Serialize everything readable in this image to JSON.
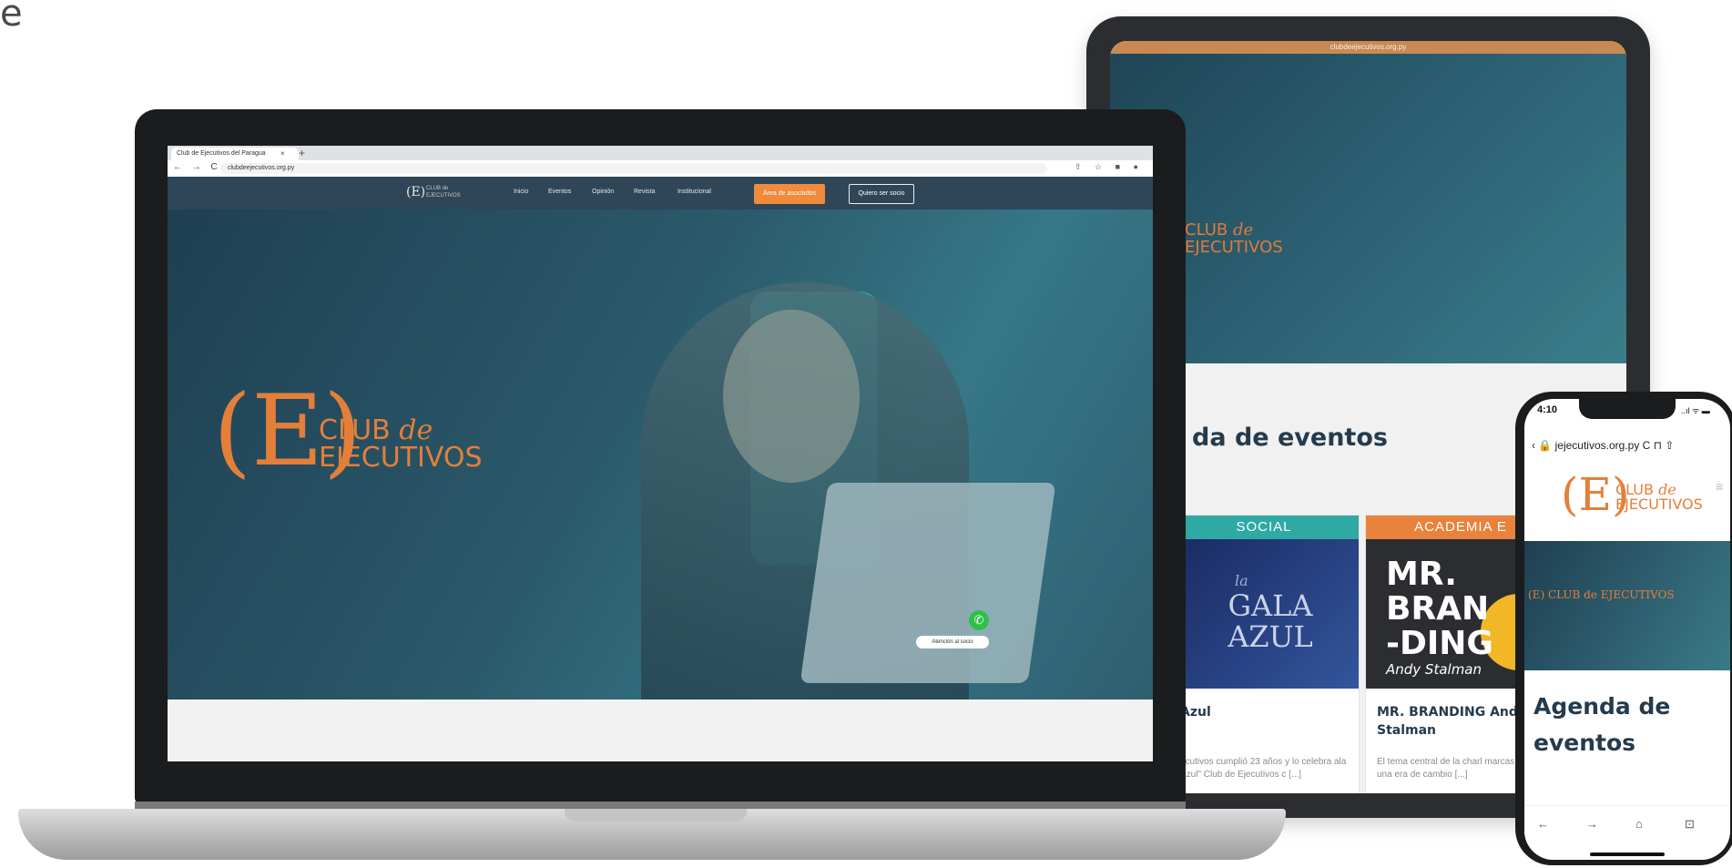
{
  "corner_text": "e",
  "tablet": {
    "url": "clubdeejecutivos.org.py",
    "logo_line1": "CLUB",
    "logo_de": "de",
    "logo_line2": "EJECUTIVOS",
    "section_title": "da de eventos",
    "cards": [
      {
        "tag": "SOCIAL",
        "img_script": "la",
        "img_line1": "GALA",
        "img_line2": "AZUL",
        "title": "Azul",
        "text": "ecutivos cumplió 23 años y lo celebra ala Azul\" Club de Ejecutivos c [...]"
      },
      {
        "tag": "ACADEMIA E",
        "img_line1": "MR.",
        "img_line2": "BRAN",
        "img_line3": "-DING",
        "img_sub": "Andy Stalman",
        "title": "MR. BRANDING Andy Stalman",
        "text": "El tema central de la charl marcas no es una era de cambio [...]"
      }
    ]
  },
  "laptop": {
    "tab_title": "Club de Ejecutivos del Paragua",
    "tab_close": "×",
    "new_tab": "+",
    "nav_buttons": "← → C",
    "address": "clubdeejecutivos.org.py",
    "actions": "⇧ ☆ ■ ●",
    "nav": {
      "logo_mark": "(E)",
      "logo_club": "CLUB de",
      "logo_ejecutivos": "EJECUTIVOS",
      "items": [
        "Inicio",
        "Eventos",
        "Opinión",
        "Revista",
        "Institucional"
      ],
      "cta": "Área de asociados",
      "outline": "Quiero ser socio"
    },
    "hero": {
      "logo_mark": "(E)",
      "logo_line1": "CLUB",
      "logo_de": "de",
      "logo_line2": "EJECUTIVOS",
      "atencion": "Atención al socio"
    }
  },
  "phone": {
    "time": "4:10",
    "status": "..ıl ᯤ ▬",
    "url_bar": "‹  🔒 jejecutivos.org.py  C  ⊓  ⇧",
    "logo_mark": "(E)",
    "logo_line1": "CLUB",
    "logo_de": "de",
    "logo_line2": "EJECUTIVOS",
    "hero_logo": "(E) CLUB de EJECUTIVOS",
    "section_title": "Agenda de eventos",
    "bottom_nav": [
      "←",
      "→",
      "⌂",
      "⊡"
    ]
  }
}
